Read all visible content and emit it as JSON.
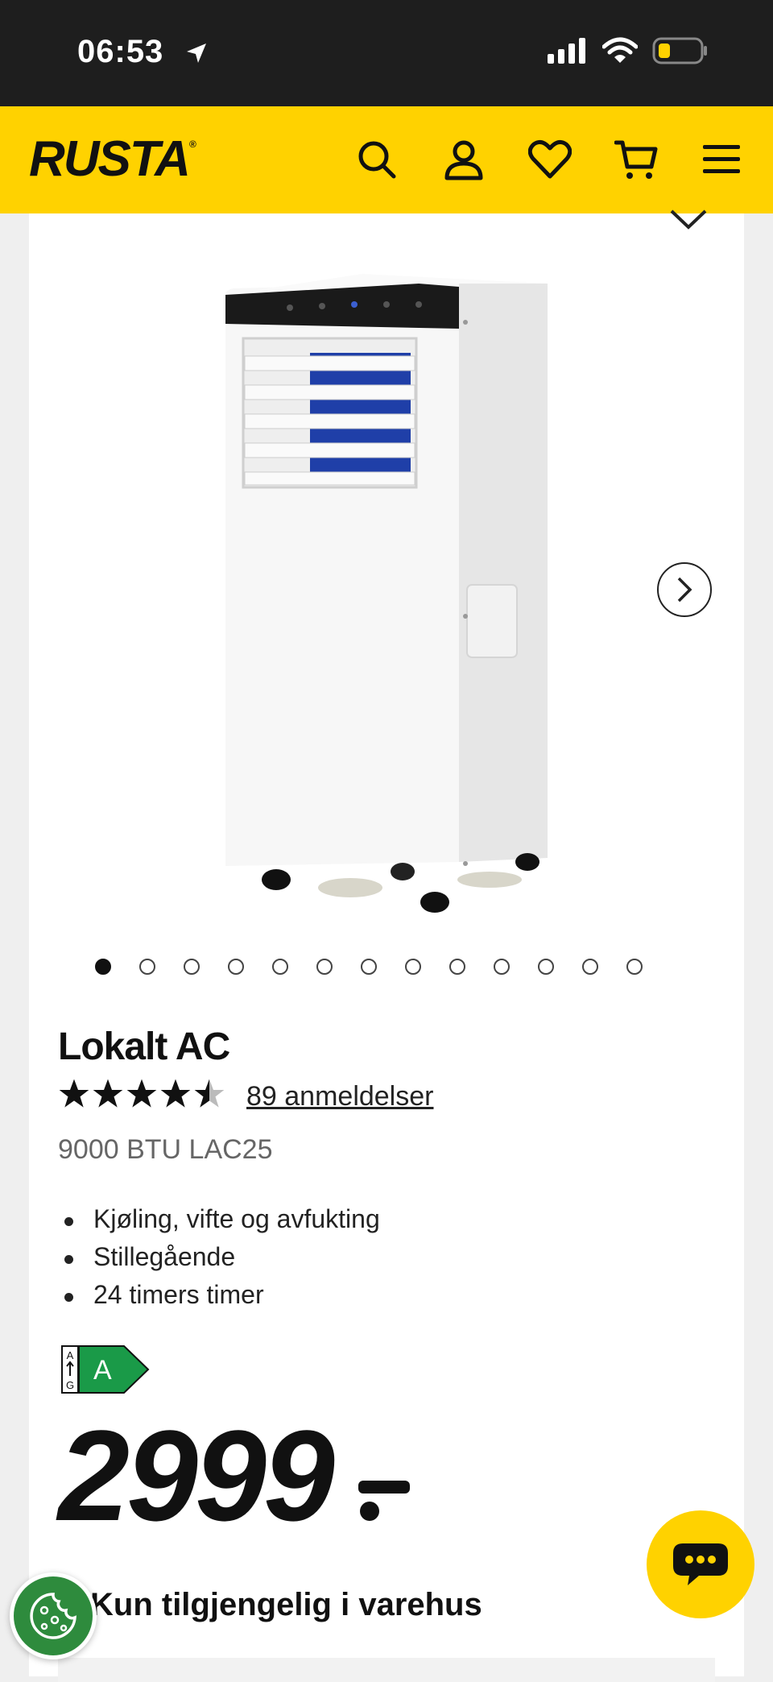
{
  "status_bar": {
    "time": "06:53"
  },
  "header": {
    "logo": "RUSTA"
  },
  "carousel": {
    "total_images": 13,
    "active_index": 0
  },
  "product": {
    "title": "Lokalt AC",
    "rating": 4.5,
    "reviews_label": "89 anmeldelser",
    "subtitle": "9000 BTU LAC25",
    "features": [
      "Kjøling, vifte og avfukting",
      "Stillegående",
      "24 timers timer"
    ],
    "energy_class": "A",
    "energy_scale": "A↑G",
    "price": "2999",
    "availability": "Kun tilgjengelig i varehus"
  },
  "colors": {
    "brand_yellow": "#ffd200",
    "energy_green": "#1a9a48",
    "cookie_green": "#2e8b3d"
  }
}
